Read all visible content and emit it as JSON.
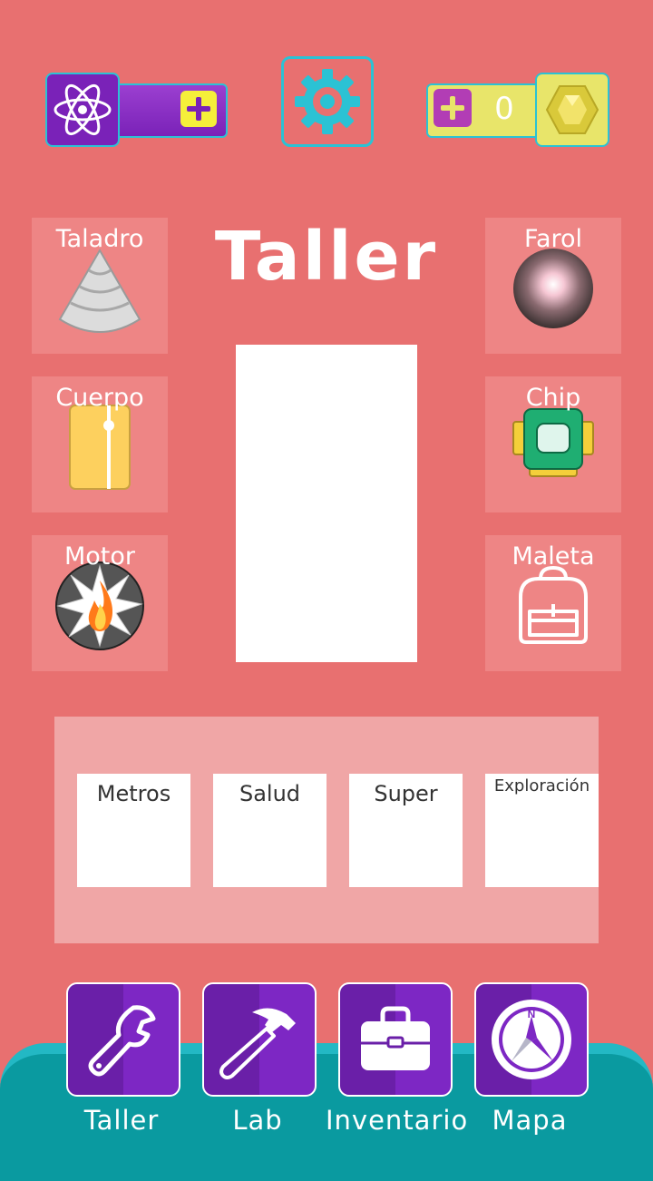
{
  "topbar": {
    "atom_icon": "atom-icon",
    "plus_icon": "plus-icon",
    "settings_icon": "gear-icon",
    "coin_count": "0",
    "gem_icon": "gem-icon",
    "colors": {
      "accent": "#2bc2d4",
      "purple": "#7a22b8",
      "yellow": "#f5ef3a"
    }
  },
  "title": "Taller",
  "parts": {
    "left": [
      {
        "label": "Taladro",
        "icon": "drill-icon"
      },
      {
        "label": "Cuerpo",
        "icon": "body-icon"
      },
      {
        "label": "Motor",
        "icon": "motor-icon"
      }
    ],
    "right": [
      {
        "label": "Farol",
        "icon": "lantern-icon"
      },
      {
        "label": "Chip",
        "icon": "chip-icon"
      },
      {
        "label": "Maleta",
        "icon": "backpack-icon"
      }
    ]
  },
  "stats": [
    {
      "label": "Metros"
    },
    {
      "label": "Salud"
    },
    {
      "label": "Super"
    },
    {
      "label": "Exploración"
    }
  ],
  "nav": [
    {
      "label": "Taller",
      "icon": "wrench-icon"
    },
    {
      "label": "Lab",
      "icon": "hammer-icon"
    },
    {
      "label": "Inventario",
      "icon": "toolbox-icon"
    },
    {
      "label": "Mapa",
      "icon": "compass-icon"
    }
  ]
}
